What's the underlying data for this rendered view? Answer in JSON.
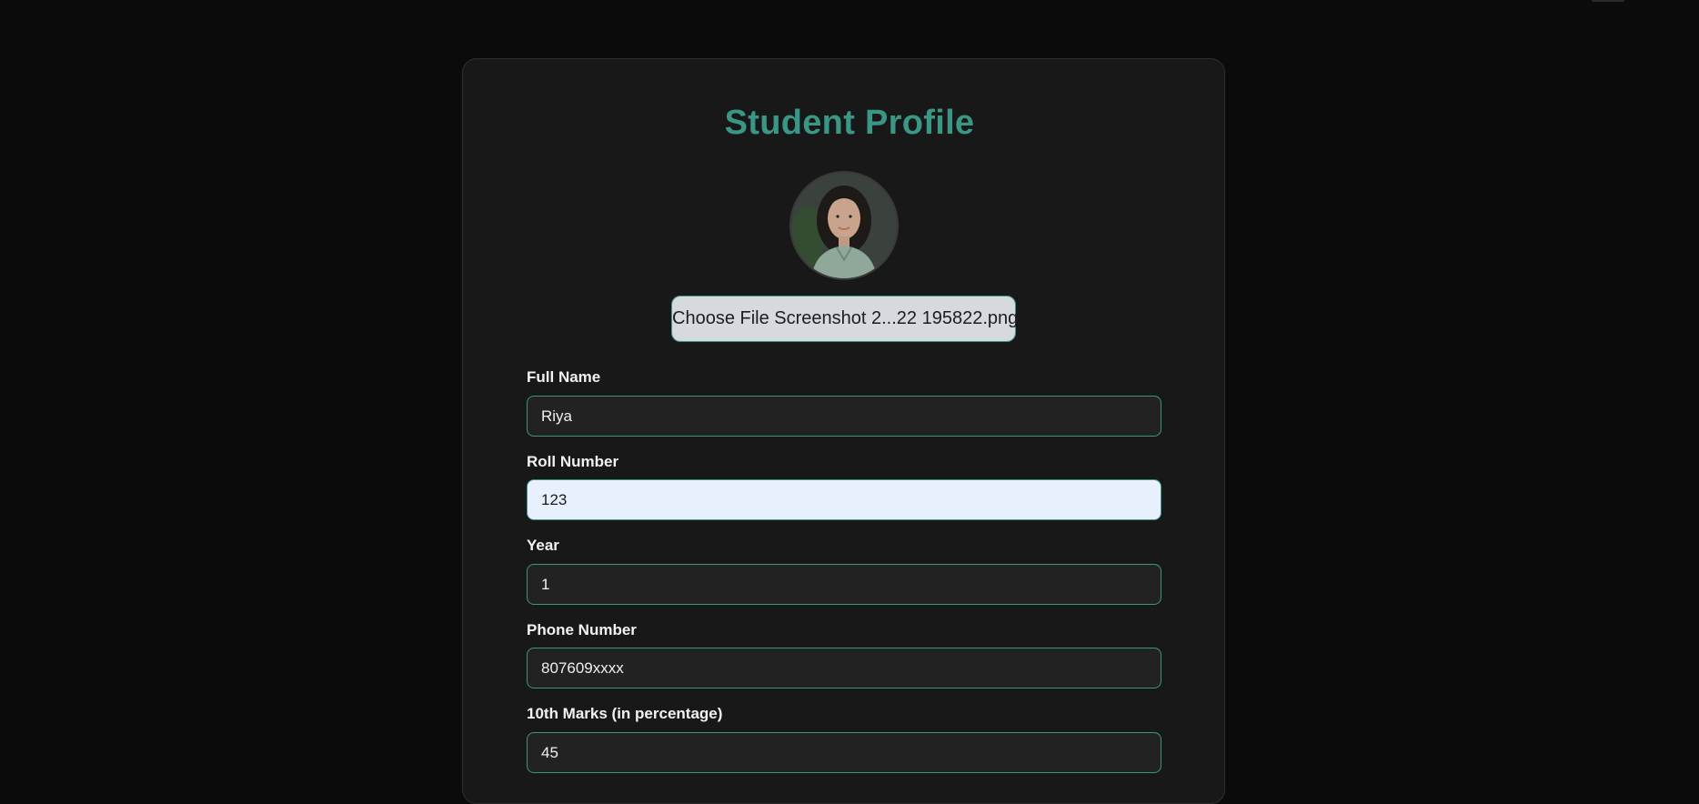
{
  "page": {
    "title": "Student Profile",
    "accent_color": "#3a9685",
    "background_color": "#0b0b0b",
    "card_color": "#181818"
  },
  "avatar": {
    "icon": "profile-photo"
  },
  "file_input": {
    "label": "Choose File Screenshot 2...22 195822.png"
  },
  "fields": [
    {
      "label": "Full Name",
      "value": "Riya"
    },
    {
      "label": "Roll Number",
      "value": "123"
    },
    {
      "label": "Year",
      "value": "1"
    },
    {
      "label": "Phone Number",
      "value": "807609xxxx"
    },
    {
      "label": "10th Marks (in percentage)",
      "value": "45"
    }
  ]
}
